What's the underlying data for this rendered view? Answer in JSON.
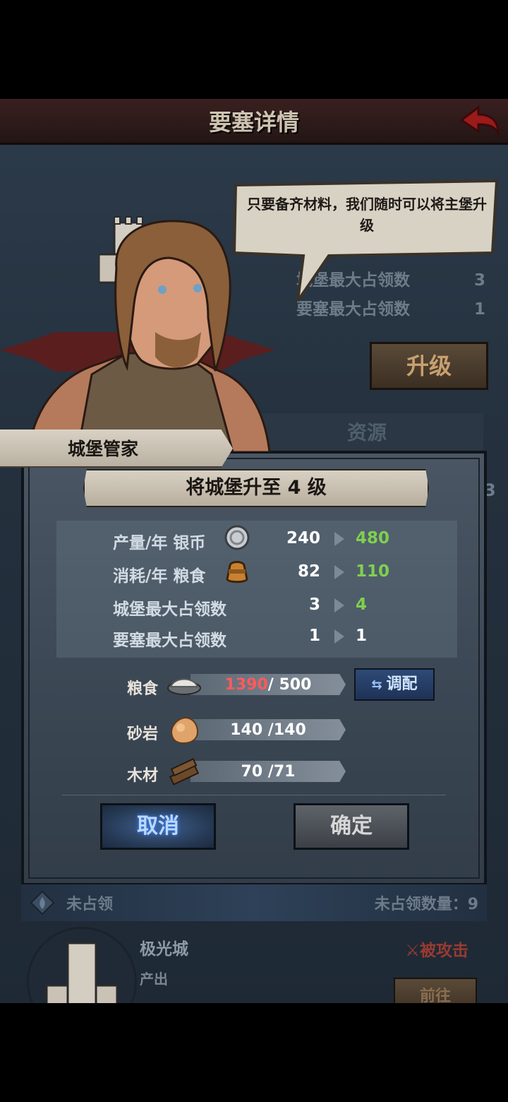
{
  "header": {
    "title": "要塞详情"
  },
  "background": {
    "rows": [
      {
        "label": "城堡最大占领数",
        "value": "3"
      },
      {
        "label": "要塞最大占领数",
        "value": "1"
      }
    ],
    "upgrade_label": "升级",
    "resource_tab": "资源",
    "side_value": "3"
  },
  "speech": {
    "text": "只要备齐材料，我们随时可以将主堡升级"
  },
  "npc": {
    "name": "城堡管家"
  },
  "dialog": {
    "heading": "将城堡升至 4 级",
    "stats": [
      {
        "label": "产量/年 银币",
        "icon": "silver-coin-icon",
        "old": "240",
        "new": "480",
        "changed": true
      },
      {
        "label": "消耗/年 粮食",
        "icon": "grain-sack-icon",
        "old": "82",
        "new": "110",
        "changed": true
      },
      {
        "label": "城堡最大占领数",
        "old": "3",
        "new": "4",
        "changed": true
      },
      {
        "label": "要塞最大占领数",
        "old": "1",
        "new": "1",
        "changed": false
      }
    ],
    "resources": [
      {
        "label": "粮食",
        "icon": "grain-pile-icon",
        "have": "1390",
        "need": "/ 500",
        "insufficient": true
      },
      {
        "label": "砂岩",
        "icon": "sandstone-icon",
        "text": "140 /140"
      },
      {
        "label": "木材",
        "icon": "lumber-icon",
        "text": "70 /71"
      }
    ],
    "allocate_label": "调配",
    "cancel_label": "取消",
    "confirm_label": "确定"
  },
  "section": {
    "label": "未占领",
    "count_label": "未占领数量：9"
  },
  "city": {
    "name": "极光城",
    "output_label": "产出",
    "status": "被攻击",
    "goto_label": "前往"
  },
  "colors": {
    "green": "#7fd04f",
    "red": "#ff5a5a",
    "blue": "#2d4a77"
  }
}
